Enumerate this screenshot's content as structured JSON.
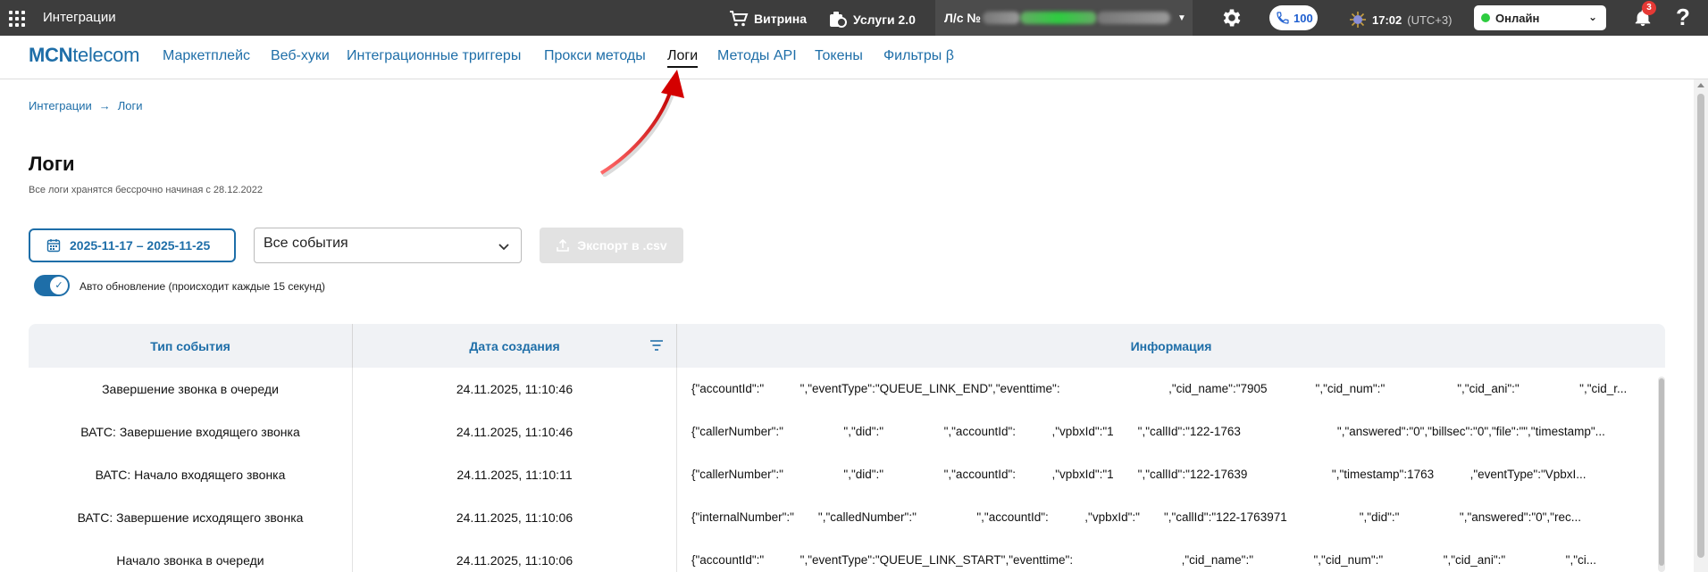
{
  "topbar": {
    "title": "Интеграции",
    "showcase": "Витрина",
    "services": "Услуги 2.0",
    "account_prefix": "Л/с №",
    "calls_count": "100",
    "time": "17:02",
    "timezone": "(UTC+3)",
    "status": "Онлайн",
    "notifications": "3",
    "help": "?"
  },
  "nav": {
    "logo_bold": "MCN",
    "logo_rest": "telecom",
    "links": [
      "Маркетплейс",
      "Веб-хуки",
      "Интеграционные триггеры",
      "Прокси методы",
      "Логи",
      "Методы API",
      "Токены",
      "Фильтры β"
    ],
    "active_index": 4
  },
  "breadcrumb": [
    "Интеграции",
    "Логи"
  ],
  "page": {
    "title": "Логи",
    "subtitle": "Все логи хранятся бессрочно начиная с 28.12.2022"
  },
  "controls": {
    "date_range": "2025-11-17 – 2025-11-25",
    "events_select": "Все события",
    "export_label": "Экспорт в .csv",
    "auto_update_label": "Авто обновление (происходит каждые 15 секунд)",
    "auto_update_on": true
  },
  "table": {
    "headers": [
      "Тип события",
      "Дата создания",
      "Информация"
    ],
    "rows": [
      {
        "type": "Завершение звонка в очереди",
        "date": "24.11.2025, 11:10:46",
        "info": "{\"accountId\":\"   \",\"eventType\":\"QUEUE_LINK_END\",\"eventtime\":         ,\"cid_name\":\"7905    \",\"cid_num\":\"      \",\"cid_ani\":\"     \",\"cid_r..."
      },
      {
        "type": "ВАТС: Завершение входящего звонка",
        "date": "24.11.2025, 11:10:46",
        "info": "{\"callerNumber\":\"     \",\"did\":\"     \",\"accountId\":   ,\"vpbxId\":\"1  \",\"callId\":\"122-1763        \",\"answered\":\"0\",\"billsec\":\"0\",\"file\":\"\",\"timestamp\"..."
      },
      {
        "type": "ВАТС: Начало входящего звонка",
        "date": "24.11.2025, 11:10:11",
        "info": "{\"callerNumber\":\"     \",\"did\":\"     \",\"accountId\":   ,\"vpbxId\":\"1  \",\"callId\":\"122-17639       \",\"timestamp\":1763   ,\"eventType\":\"VpbxI..."
      },
      {
        "type": "ВАТС: Завершение исходящего звонка",
        "date": "24.11.2025, 11:10:06",
        "info": "{\"internalNumber\":\"  \",\"calledNumber\":\"     \",\"accountId\":   ,\"vpbxId\":\"  \",\"callId\":\"122-1763971      \",\"did\":\"     \",\"answered\":\"0\",\"rec..."
      },
      {
        "type": "Начало звонка в очереди",
        "date": "24.11.2025, 11:10:06",
        "info": "{\"accountId\":\"   \",\"eventType\":\"QUEUE_LINK_START\",\"eventtime\":         ,\"cid_name\":\"     \",\"cid_num\":\"     \",\"cid_ani\":\"     \",\"ci..."
      }
    ]
  },
  "colors": {
    "topbar_bg": "#3d3d3d",
    "accent": "#1e6ea8",
    "online": "#2ecc40",
    "badge": "#e53935",
    "annotation_arrow": "#e01010"
  }
}
